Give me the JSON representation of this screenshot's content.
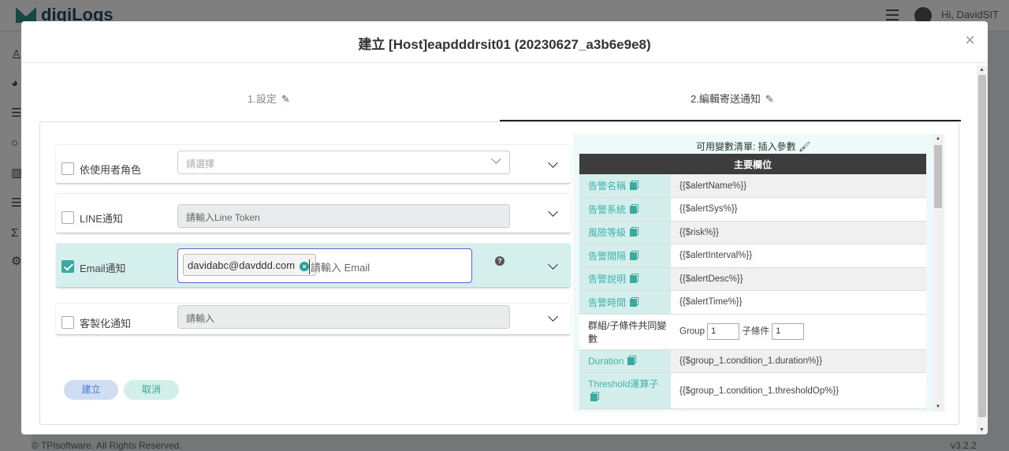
{
  "app": {
    "logo": "digiLogs",
    "user": "Hi, DavidSIT",
    "footer": "© TPIsoftware. All Rights Reserved.",
    "version": "v3.2.2"
  },
  "modal": {
    "title": "建立 [Host]eapdddrsit01 (20230627_a3b6e9e8)",
    "close": "×",
    "steps": [
      {
        "label": "1.設定",
        "icon": "pencil-icon"
      },
      {
        "label": "2.編輯寄送通知",
        "icon": "pencil-icon",
        "active": true
      }
    ]
  },
  "form": {
    "role": {
      "label": "依使用者角色",
      "checked": false,
      "placeholder": "請選擇"
    },
    "line": {
      "label": "LINE通知",
      "checked": false,
      "placeholder": "請輸入Line Token"
    },
    "email": {
      "label": "Email通知",
      "checked": true,
      "tag": "davidabc@davddd.com",
      "placeholder": "請輸入 Email",
      "help": "?"
    },
    "custom": {
      "label": "客製化通知",
      "checked": false,
      "placeholder": "請輸入"
    },
    "buttons": {
      "create": "建立",
      "cancel": "取消"
    }
  },
  "variables": {
    "title": "可用變數清單: 插入參數",
    "header": "主要欄位",
    "rows": [
      {
        "key": "告警名稱",
        "value": "{{$alertName%}}"
      },
      {
        "key": "告警系統",
        "value": "{{$alertSys%}}"
      },
      {
        "key": "風險等級",
        "value": "{{$risk%}}"
      },
      {
        "key": "告警間隔",
        "value": "{{$alertInterval%}}"
      },
      {
        "key": "告警說明",
        "value": "{{$alertDesc%}}"
      },
      {
        "key": "告警時間",
        "value": "{{$alertTime%}}"
      }
    ],
    "group_row": {
      "key": "群組/子條件共同變數",
      "group_label": "Group",
      "group_value": "1",
      "cond_label": "子條件",
      "cond_value": "1"
    },
    "rows2": [
      {
        "key": "Duration",
        "value": "{{$group_1.condition_1.duration%}}"
      },
      {
        "key": "Threshold運算子",
        "value": "{{$group_1.condition_1.thresholdOp%}}"
      }
    ]
  }
}
